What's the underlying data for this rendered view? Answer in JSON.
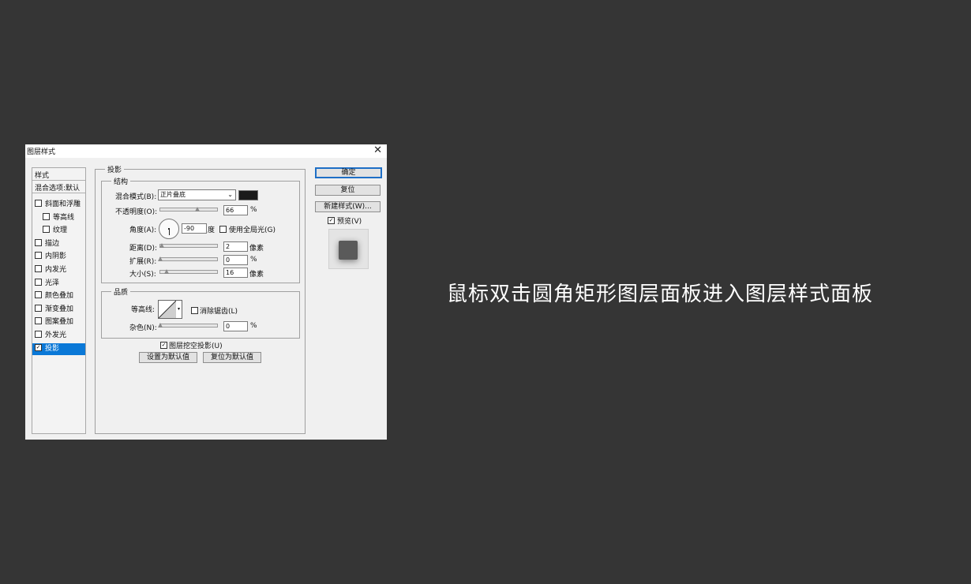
{
  "dialog": {
    "title": "图层样式",
    "close_glyph": "✕",
    "left_panel": {
      "styles_header": "样式",
      "blend_options": "混合选项:默认",
      "items": [
        {
          "label": "斜面和浮雕",
          "checked": false,
          "indent": false
        },
        {
          "label": "等高线",
          "checked": false,
          "indent": true
        },
        {
          "label": "纹理",
          "checked": false,
          "indent": true
        },
        {
          "label": "描边",
          "checked": false,
          "indent": false
        },
        {
          "label": "内阴影",
          "checked": false,
          "indent": false
        },
        {
          "label": "内发光",
          "checked": false,
          "indent": false
        },
        {
          "label": "光泽",
          "checked": false,
          "indent": false
        },
        {
          "label": "颜色叠加",
          "checked": false,
          "indent": false
        },
        {
          "label": "渐变叠加",
          "checked": false,
          "indent": false
        },
        {
          "label": "图案叠加",
          "checked": false,
          "indent": false
        },
        {
          "label": "外发光",
          "checked": false,
          "indent": false
        },
        {
          "label": "投影",
          "checked": true,
          "indent": false,
          "selected": true
        }
      ]
    },
    "main": {
      "section_title": "投影",
      "structure": {
        "title": "结构",
        "blend_mode_label": "混合模式(B):",
        "blend_mode_value": "正片叠底",
        "shadow_color": "#1a1a1a",
        "opacity_label": "不透明度(O):",
        "opacity_value": "66",
        "opacity_fraction": 0.66,
        "percent": "%",
        "angle_label": "角度(A):",
        "angle_value": "-90",
        "angle_unit": "度",
        "global_light_label": "使用全局光(G)",
        "global_light_checked": false,
        "distance_label": "距离(D):",
        "distance_value": "2",
        "distance_unit": "像素",
        "spread_label": "扩展(R):",
        "spread_value": "0",
        "spread_unit": "%",
        "size_label": "大小(S):",
        "size_value": "16",
        "size_unit": "像素"
      },
      "quality": {
        "title": "品质",
        "contour_label": "等高线:",
        "antialias_label": "消除锯齿(L)",
        "antialias_checked": false,
        "noise_label": "杂色(N):",
        "noise_value": "0",
        "noise_unit": "%"
      },
      "knockout_label": "图层挖空投影(U)",
      "knockout_checked": true,
      "make_default_label": "设置为默认值",
      "reset_default_label": "复位为默认值"
    },
    "buttons": {
      "ok": "确定",
      "reset": "复位",
      "new_style": "新建样式(W)...",
      "preview_label": "预览(V)",
      "preview_checked": true
    }
  },
  "caption": "鼠标双击圆角矩形图层面板进入图层样式面板",
  "colors": {
    "background": "#353535",
    "selection": "#0a78d7",
    "primary_border": "#1e6fc6"
  }
}
